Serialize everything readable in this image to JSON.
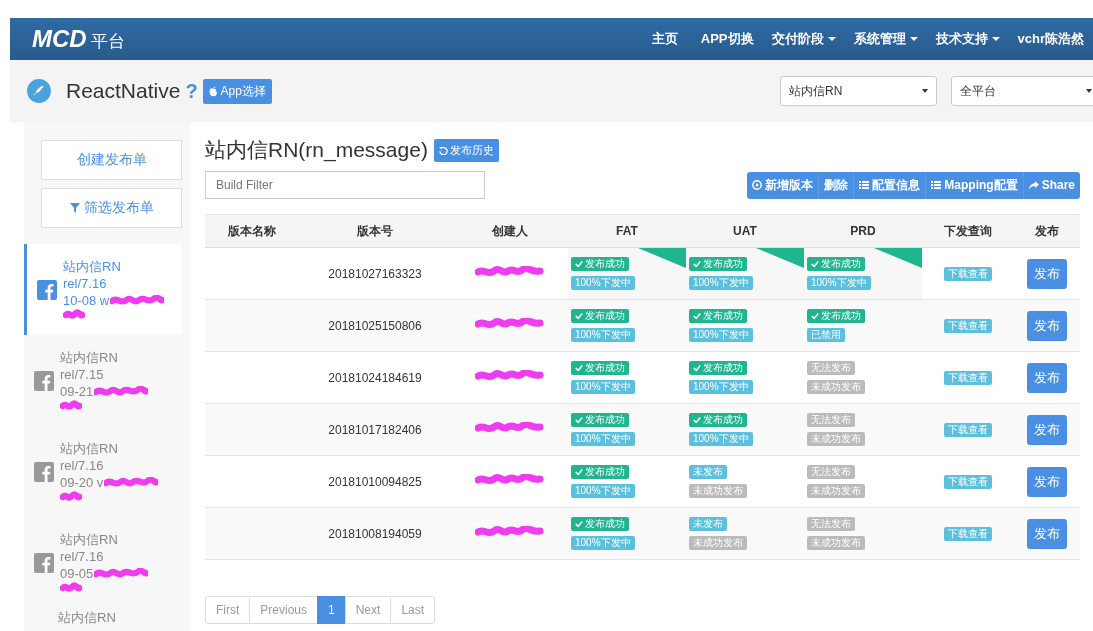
{
  "brand": {
    "logo": "MCD",
    "suffix": "平台"
  },
  "nav": [
    {
      "label": "主页",
      "dropdown": false
    },
    {
      "label": "APP切换",
      "dropdown": false
    },
    {
      "label": "交付阶段",
      "dropdown": true
    },
    {
      "label": "系统管理",
      "dropdown": true
    },
    {
      "label": "技术支持",
      "dropdown": true
    },
    {
      "label": "vchr陈浩然",
      "dropdown": false
    }
  ],
  "subheader": {
    "title": "ReactNative",
    "help": "?",
    "app_button": "App选择",
    "selects": [
      {
        "value": "站内信RN"
      },
      {
        "value": "全平台"
      }
    ]
  },
  "sidebar": {
    "buttons": [
      {
        "label": "创建发布单"
      },
      {
        "label": "筛选发布单"
      }
    ],
    "items": [
      {
        "name": "站内信RN",
        "branch": "rel/7.16",
        "date": "10-08 w",
        "selected": true
      },
      {
        "name": "站内信RN",
        "branch": "rel/7.15",
        "date": "09-21",
        "selected": false
      },
      {
        "name": "站内信RN",
        "branch": "rel/7.16",
        "date": "09-20 v",
        "selected": false
      },
      {
        "name": "站内信RN",
        "branch": "rel/7.16",
        "date": "09-05",
        "selected": false
      }
    ],
    "partial_item": "站内信RN"
  },
  "main": {
    "title": "站内信RN(rn_message)",
    "history_button": "发布历史",
    "filter": {
      "placeholder": "Build Filter"
    },
    "toolbar": [
      {
        "label": "新增版本"
      },
      {
        "label": "删除"
      },
      {
        "label": "配置信息"
      },
      {
        "label": "Mapping配置"
      },
      {
        "label": "Share"
      }
    ]
  },
  "table": {
    "columns": [
      "版本名称",
      "版本号",
      "创建人",
      "FAT",
      "UAT",
      "PRD",
      "下发查询",
      "发布"
    ],
    "rows": [
      {
        "version": "20181027163323",
        "stages": [
          {
            "flagged": true,
            "status": {
              "kind": "success",
              "label": "发布成功"
            },
            "detail": {
              "kind": "info",
              "label": "100%下发中"
            }
          },
          {
            "flagged": true,
            "status": {
              "kind": "success",
              "label": "发布成功"
            },
            "detail": {
              "kind": "info",
              "label": "100%下发中"
            }
          },
          {
            "flagged": true,
            "status": {
              "kind": "success",
              "label": "发布成功"
            },
            "detail": {
              "kind": "info",
              "label": "100%下发中"
            }
          }
        ],
        "query": "下载查看",
        "action": "发布"
      },
      {
        "version": "20181025150806",
        "stages": [
          {
            "flagged": false,
            "status": {
              "kind": "success",
              "label": "发布成功"
            },
            "detail": {
              "kind": "info",
              "label": "100%下发中"
            }
          },
          {
            "flagged": false,
            "status": {
              "kind": "success",
              "label": "发布成功"
            },
            "detail": {
              "kind": "info",
              "label": "100%下发中"
            }
          },
          {
            "flagged": false,
            "status": {
              "kind": "success",
              "label": "发布成功"
            },
            "detail": {
              "kind": "info",
              "label": "已禁用"
            }
          }
        ],
        "query": "下载查看",
        "action": "发布"
      },
      {
        "version": "20181024184619",
        "stages": [
          {
            "flagged": false,
            "status": {
              "kind": "success",
              "label": "发布成功"
            },
            "detail": {
              "kind": "info",
              "label": "100%下发中"
            }
          },
          {
            "flagged": false,
            "status": {
              "kind": "success",
              "label": "发布成功"
            },
            "detail": {
              "kind": "info",
              "label": "100%下发中"
            }
          },
          {
            "flagged": false,
            "status": {
              "kind": "muted",
              "label": "无法发布"
            },
            "detail": {
              "kind": "muted",
              "label": "未成功发布"
            }
          }
        ],
        "query": "下载查看",
        "action": "发布"
      },
      {
        "version": "20181017182406",
        "stages": [
          {
            "flagged": false,
            "status": {
              "kind": "success",
              "label": "发布成功"
            },
            "detail": {
              "kind": "info",
              "label": "100%下发中"
            }
          },
          {
            "flagged": false,
            "status": {
              "kind": "success",
              "label": "发布成功"
            },
            "detail": {
              "kind": "info",
              "label": "100%下发中"
            }
          },
          {
            "flagged": false,
            "status": {
              "kind": "muted",
              "label": "无法发布"
            },
            "detail": {
              "kind": "muted",
              "label": "未成功发布"
            }
          }
        ],
        "query": "下载查看",
        "action": "发布"
      },
      {
        "version": "20181010094825",
        "stages": [
          {
            "flagged": false,
            "status": {
              "kind": "success",
              "label": "发布成功"
            },
            "detail": {
              "kind": "info",
              "label": "100%下发中"
            }
          },
          {
            "flagged": false,
            "status": {
              "kind": "info",
              "label": "未发布"
            },
            "detail": {
              "kind": "muted",
              "label": "未成功发布"
            }
          },
          {
            "flagged": false,
            "status": {
              "kind": "muted",
              "label": "无法发布"
            },
            "detail": {
              "kind": "muted",
              "label": "未成功发布"
            }
          }
        ],
        "query": "下载查看",
        "action": "发布"
      },
      {
        "version": "20181008194059",
        "stages": [
          {
            "flagged": false,
            "status": {
              "kind": "success",
              "label": "发布成功"
            },
            "detail": {
              "kind": "info",
              "label": "100%下发中"
            }
          },
          {
            "flagged": false,
            "status": {
              "kind": "info",
              "label": "未发布"
            },
            "detail": {
              "kind": "muted",
              "label": "未成功发布"
            }
          },
          {
            "flagged": false,
            "status": {
              "kind": "muted",
              "label": "无法发布"
            },
            "detail": {
              "kind": "muted",
              "label": "未成功发布"
            }
          }
        ],
        "query": "下载查看",
        "action": "发布"
      }
    ]
  },
  "pagination": [
    {
      "label": "First",
      "selected": false
    },
    {
      "label": "Previous",
      "selected": false
    },
    {
      "label": "1",
      "selected": true
    },
    {
      "label": "Next",
      "selected": false
    },
    {
      "label": "Last",
      "selected": false
    }
  ]
}
